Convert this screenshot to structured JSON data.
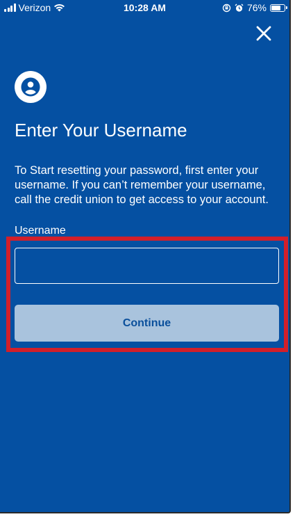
{
  "status_bar": {
    "carrier": "Verizon",
    "time": "10:28 AM",
    "battery": "76%",
    "battery_level": 0.76
  },
  "header": {
    "close_icon": "close-icon"
  },
  "main": {
    "avatar_icon": "user-circle-icon",
    "title": "Enter Your Username",
    "description": "To Start resetting your password, first enter your username. If you can’t remember your username, call the credit union to get access to your account.",
    "username_label": "Username",
    "username_value": "",
    "continue_label": "Continue"
  },
  "colors": {
    "background": "#0550a2",
    "button_bg": "#a9c3dd",
    "button_text": "#0a4f9b",
    "highlight": "#d21f2a"
  }
}
